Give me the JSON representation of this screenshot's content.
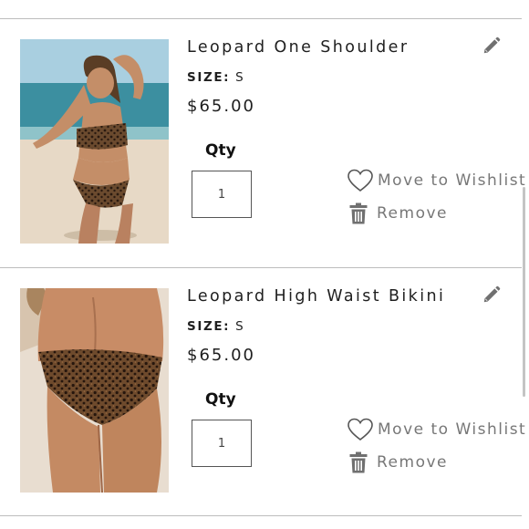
{
  "cart": {
    "items": [
      {
        "name": "Leopard One Shoulder",
        "size_label": "SIZE:",
        "size_value": "S",
        "price": "$65.00",
        "qty_label": "Qty",
        "quantity": "1",
        "wishlist_label": "Move to Wishlist",
        "remove_label": "Remove",
        "image_subject": "model on beach wearing leopard one-shoulder bikini"
      },
      {
        "name": "Leopard High Waist Bikini",
        "size_label": "SIZE:",
        "size_value": "S",
        "price": "$65.00",
        "qty_label": "Qty",
        "quantity": "1",
        "wishlist_label": "Move to Wishlist",
        "remove_label": "Remove",
        "image_subject": "back view of leopard high waist bikini bottom"
      }
    ]
  },
  "icons": {
    "edit": "pencil-icon",
    "wishlist": "heart-outline-icon",
    "remove": "trash-can-icon"
  },
  "colors": {
    "text": "#1f1f1f",
    "action_text": "#777777",
    "icon": "#707070",
    "divider": "#bdbdbd"
  }
}
